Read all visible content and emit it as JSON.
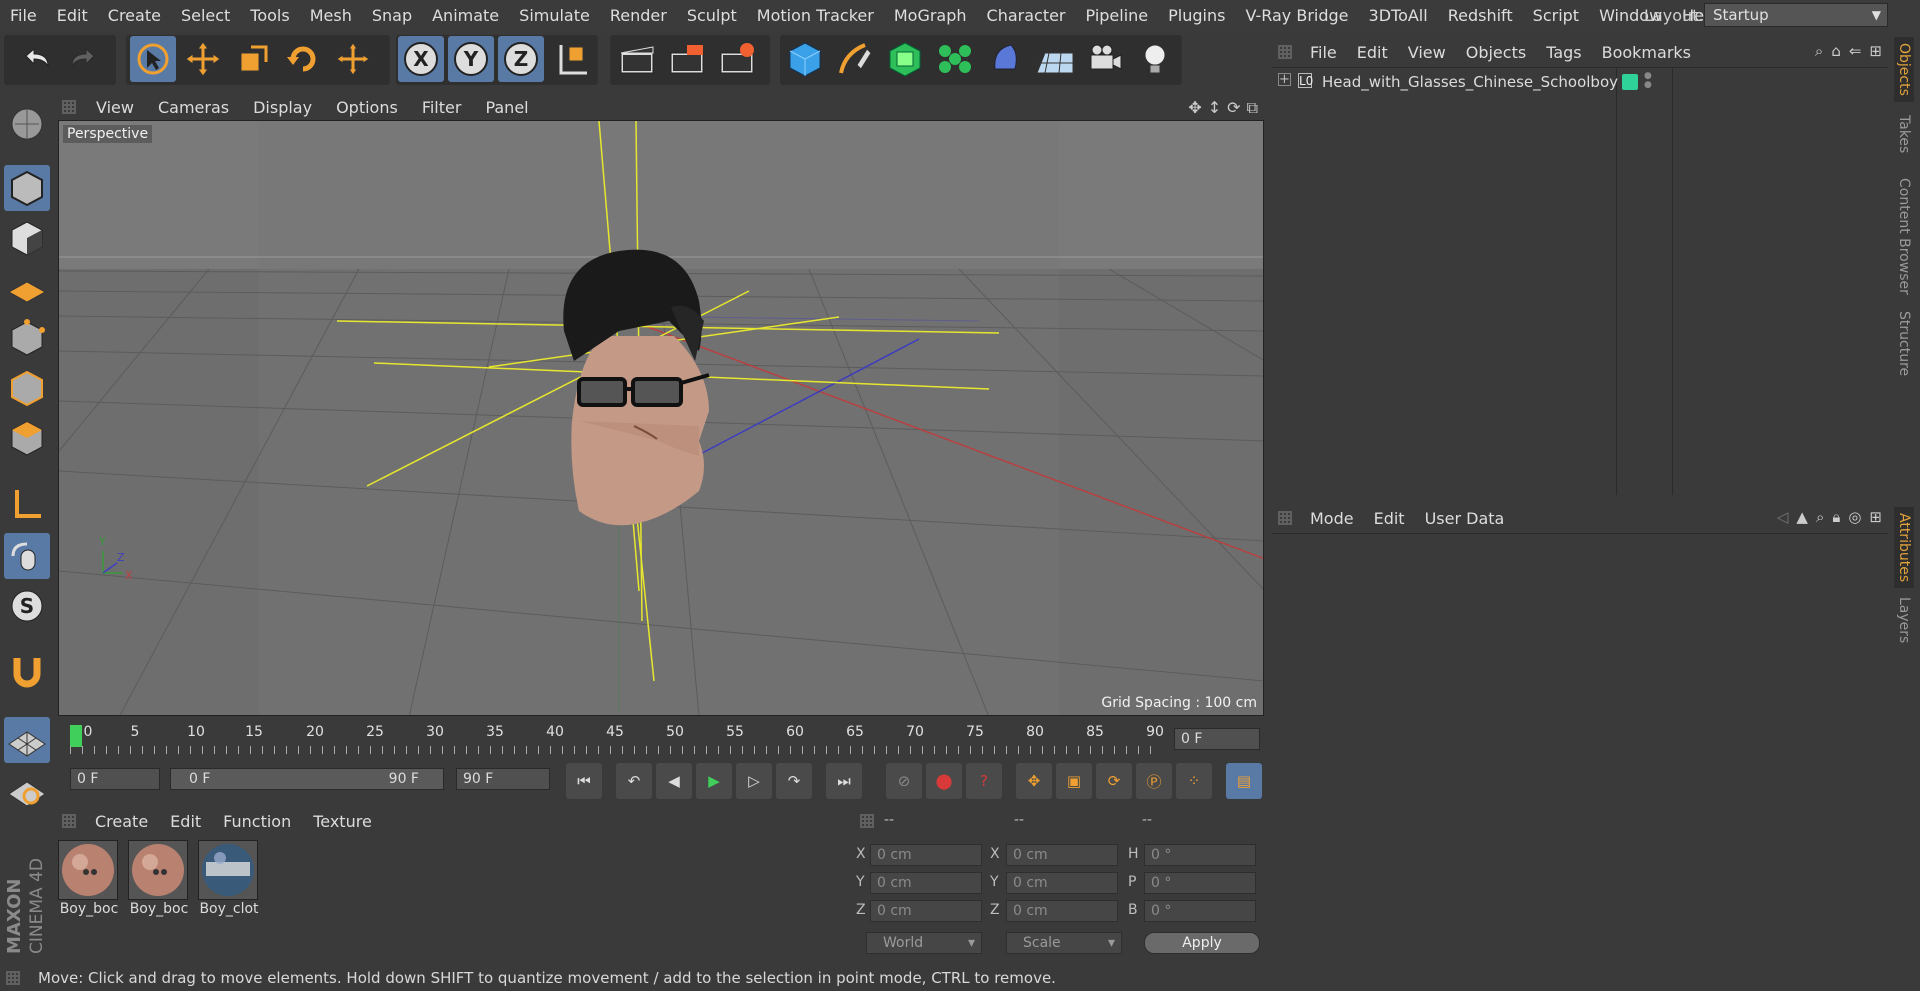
{
  "menubar": {
    "items": [
      "File",
      "Edit",
      "Create",
      "Select",
      "Tools",
      "Mesh",
      "Snap",
      "Animate",
      "Simulate",
      "Render",
      "Sculpt",
      "Motion Tracker",
      "MoGraph",
      "Character",
      "Pipeline",
      "Plugins",
      "V-Ray Bridge",
      "3DToAll",
      "Redshift",
      "Script",
      "Window",
      "Help"
    ],
    "layout_label": "Layout:",
    "layout_value": "Startup"
  },
  "viewport": {
    "menu": [
      "View",
      "Cameras",
      "Display",
      "Options",
      "Filter",
      "Panel"
    ],
    "camera_label": "Perspective",
    "grid_spacing": "Grid Spacing : 100 cm"
  },
  "timeline": {
    "ticks": [
      "0",
      "5",
      "10",
      "15",
      "20",
      "25",
      "30",
      "35",
      "40",
      "45",
      "50",
      "55",
      "60",
      "65",
      "70",
      "75",
      "80",
      "85",
      "90"
    ],
    "current_frame": "0 F",
    "start_frame": "0 F",
    "range_start": "0 F",
    "range_end": "90 F",
    "end_frame": "90 F"
  },
  "materials": {
    "menu": [
      "Create",
      "Edit",
      "Function",
      "Texture"
    ],
    "items": [
      {
        "name": "Boy_boc"
      },
      {
        "name": "Boy_boc"
      },
      {
        "name": "Boy_clot"
      }
    ]
  },
  "coords": {
    "headers": [
      "--",
      "--",
      "--"
    ],
    "rows": [
      {
        "l1": "X",
        "v1": "0 cm",
        "l2": "X",
        "v2": "0 cm",
        "l3": "H",
        "v3": "0 °"
      },
      {
        "l1": "Y",
        "v1": "0 cm",
        "l2": "Y",
        "v2": "0 cm",
        "l3": "P",
        "v3": "0 °"
      },
      {
        "l1": "Z",
        "v1": "0 cm",
        "l2": "Z",
        "v2": "0 cm",
        "l3": "B",
        "v3": "0 °"
      }
    ],
    "space": "World",
    "mode": "Scale",
    "apply": "Apply"
  },
  "objects": {
    "menu": [
      "File",
      "Edit",
      "View",
      "Objects",
      "Tags",
      "Bookmarks"
    ],
    "items": [
      {
        "name": "Head_with_Glasses_Chinese_Schoolboy",
        "tag_color": "#2fd39a"
      }
    ]
  },
  "attributes": {
    "menu": [
      "Mode",
      "Edit",
      "User Data"
    ]
  },
  "right_tabs": [
    "Objects",
    "Takes",
    "Content Browser",
    "Structure",
    "Attributes",
    "Layers"
  ],
  "status": "Move: Click and drag to move elements. Hold down SHIFT to quantize movement / add to the selection in point mode, CTRL to remove.",
  "branding": {
    "maxon": "MAXON",
    "product": "CINEMA 4D"
  },
  "colors": {
    "selection_blue": "#5a7aa6",
    "accent_orange": "#f0a030",
    "play_green": "#3fcf5a",
    "record_red": "#d83a3a",
    "axis_yellow": "#e6e62e"
  }
}
